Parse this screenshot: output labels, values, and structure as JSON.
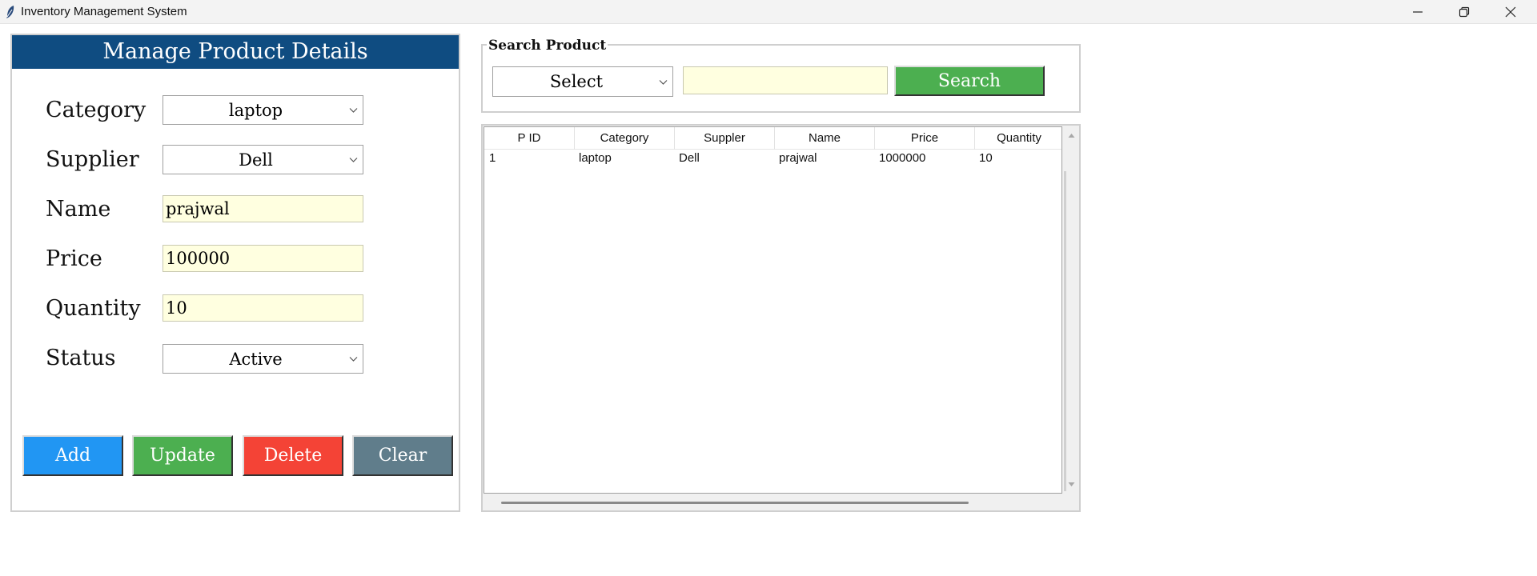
{
  "window": {
    "title": "Inventory Management System"
  },
  "form": {
    "heading": "Manage Product Details",
    "labels": {
      "category": "Category",
      "supplier": "Supplier",
      "name": "Name",
      "price": "Price",
      "quantity": "Quantity",
      "status": "Status"
    },
    "values": {
      "category": "laptop",
      "supplier": "Dell",
      "name": "prajwal",
      "price": "100000",
      "quantity": "10",
      "status": "Active"
    },
    "buttons": {
      "add": "Add",
      "update": "Update",
      "delete": "Delete",
      "clear": "Clear"
    },
    "colors": {
      "heading": "#0f4c81",
      "add": "#2196f3",
      "update": "#4caf50",
      "delete": "#f44336",
      "clear": "#607d8b",
      "entry_bg": "#ffffe0"
    }
  },
  "search": {
    "legend": "Search Product",
    "select_value": "Select",
    "input_value": "",
    "button": "Search"
  },
  "table": {
    "columns": [
      "P ID",
      "Category",
      "Suppler",
      "Name",
      "Price",
      "Quantity"
    ],
    "rows": [
      [
        "1",
        "laptop",
        "Dell",
        "prajwal",
        "1000000",
        "10"
      ]
    ]
  },
  "icons": {
    "app": "feather-icon",
    "minimize": "minimize-icon",
    "restore": "restore-icon",
    "close": "close-icon",
    "dropdown": "chevron-down-icon"
  }
}
